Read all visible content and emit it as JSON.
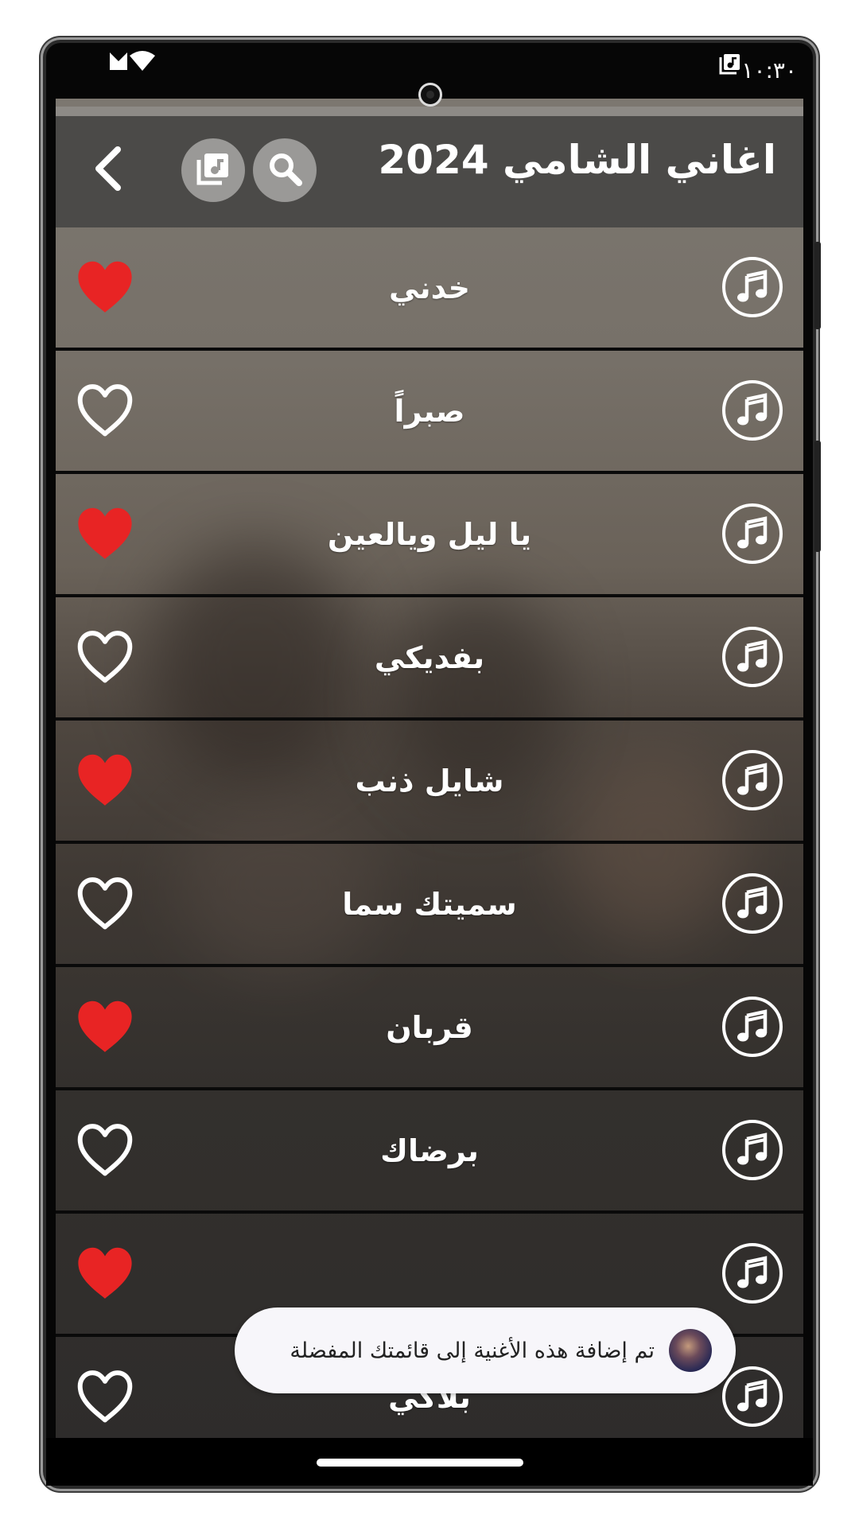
{
  "status_bar": {
    "time": "١٠:٣٠",
    "icons": [
      "signal-icon",
      "wifi-icon",
      "music-library-icon"
    ]
  },
  "toolbar": {
    "title": "اغاني الشامي 2024",
    "search_icon": "search-icon",
    "library_icon": "music-library-icon",
    "back_icon": "chevron-left-icon"
  },
  "songs": [
    {
      "title": "خدني",
      "favorite": true
    },
    {
      "title": "صبراً",
      "favorite": false
    },
    {
      "title": "يا ليل ويالعين",
      "favorite": true
    },
    {
      "title": "بفديكي",
      "favorite": false
    },
    {
      "title": "شايل ذنب",
      "favorite": true
    },
    {
      "title": "سميتك سما",
      "favorite": false
    },
    {
      "title": "قربان",
      "favorite": true
    },
    {
      "title": "برضاك",
      "favorite": false
    },
    {
      "title": "",
      "favorite": true
    },
    {
      "title": "بلاكي",
      "favorite": false
    }
  ],
  "toast": {
    "message": "تم إضافة هذه الأغنية إلى قائمتك المفضلة"
  },
  "colors": {
    "heart_filled": "#e82424",
    "heart_outline": "#ffffff",
    "toolbar_bg": "#4b4a48",
    "toast_bg": "#f7f6fa"
  }
}
